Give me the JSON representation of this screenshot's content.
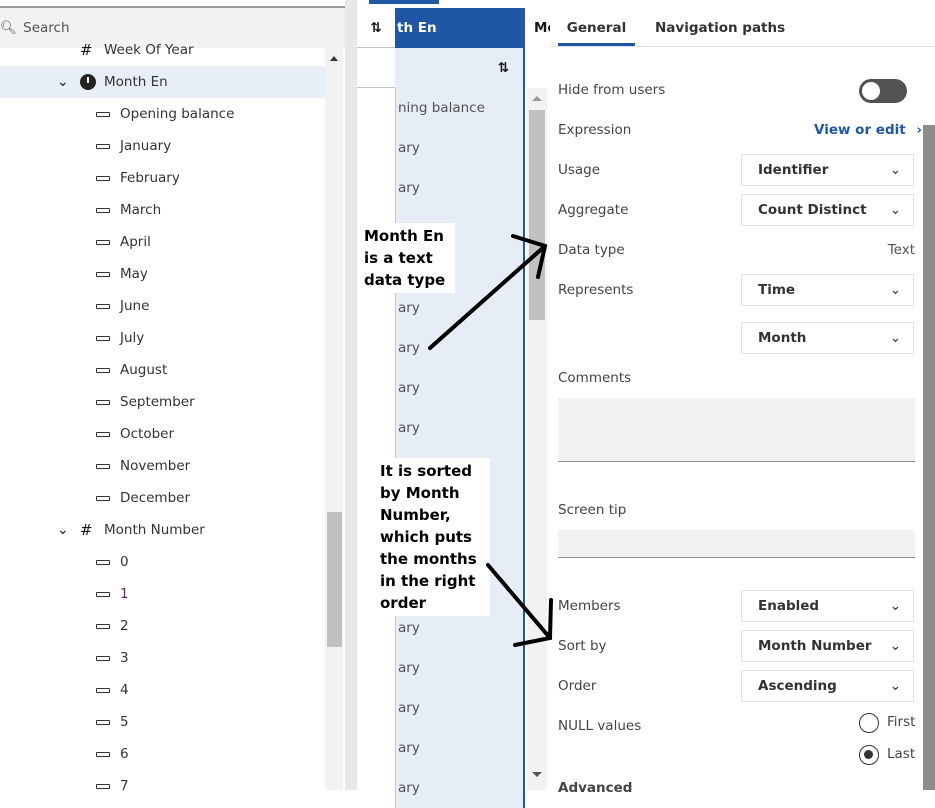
{
  "search": {
    "placeholder": "Search"
  },
  "tree": {
    "items": [
      {
        "label": "Week Of Year",
        "icon": "hash-icon"
      },
      {
        "label": "Month En",
        "icon": "clock-icon",
        "expanded": true,
        "selected": true
      },
      {
        "label": "Opening balance"
      },
      {
        "label": "January"
      },
      {
        "label": "February"
      },
      {
        "label": "March"
      },
      {
        "label": "April"
      },
      {
        "label": "May"
      },
      {
        "label": "June"
      },
      {
        "label": "July"
      },
      {
        "label": "August"
      },
      {
        "label": "September"
      },
      {
        "label": "October"
      },
      {
        "label": "November"
      },
      {
        "label": "December"
      },
      {
        "label": "Month Number",
        "icon": "hash-icon",
        "expanded": true
      },
      {
        "label": "0"
      },
      {
        "label": "1"
      },
      {
        "label": "2"
      },
      {
        "label": "3"
      },
      {
        "label": "4"
      },
      {
        "label": "5"
      },
      {
        "label": "6"
      },
      {
        "label": "7"
      }
    ]
  },
  "grid": {
    "header": "th En",
    "next_header": "Mo",
    "rows": [
      "ning balance",
      "ary",
      "ary",
      "ary",
      "ary",
      "ary",
      "ary",
      "ary",
      "ary",
      "ary",
      "ary",
      "ary",
      "ary",
      "ary",
      "ary",
      "ary",
      "ary",
      "ary"
    ]
  },
  "properties": {
    "tabs": [
      "General",
      "Navigation paths"
    ],
    "hide_from_users": "Hide from users",
    "expression": "Expression",
    "view_or_edit": "View or edit",
    "usage": "Usage",
    "usage_value": "Identifier",
    "aggregate": "Aggregate",
    "aggregate_value": "Count Distinct",
    "data_type": "Data type",
    "data_type_value": "Text",
    "represents": "Represents",
    "represents_value": "Time",
    "represents_sub": "Month",
    "comments": "Comments",
    "screen_tip": "Screen tip",
    "members": "Members",
    "members_value": "Enabled",
    "sort_by": "Sort by",
    "sort_by_value": "Month Number",
    "order": "Order",
    "order_value": "Ascending",
    "null_values": "NULL values",
    "null_first": "First",
    "null_last": "Last",
    "advanced": "Advanced"
  },
  "annotations": {
    "note1": "Month En is a text data type",
    "note2": "It is sorted by Month Number, which puts the months in the right order"
  },
  "colors": {
    "accent": "#1f57a4",
    "selected_bg": "#e8eef6"
  }
}
